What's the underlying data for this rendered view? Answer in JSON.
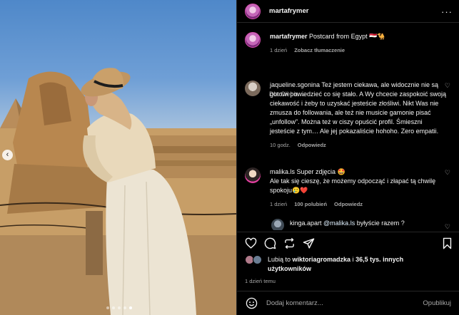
{
  "post": {
    "username": "martafrymer",
    "caption_user": "martafrymer",
    "caption_text": "Postcard from Egypt 🇪🇬🐪",
    "caption_time": "1 dzień",
    "translate_label": "Zobacz tłumaczenie",
    "sort_label": "Dla Ciebie"
  },
  "comments": [
    {
      "user": "jaqueline.sgonina",
      "text": "Też jestem ciekawa, ale widocznie nie są gotowi powiedzieć co się stało. A Wy chcecie zaspokoić swoją ciekawość i żeby to uzyskać jesteście złośliwi. Nikt Was nie zmusza do followania, ale też nie musicie gamonie pisać „unfollow”. Można też w ciszy opuścić profil. Śmieszni jesteście z tym… Ale jej pokazaliście hohoho. Zero empatii.",
      "time": "10 godz.",
      "reply": "Odpowiedz"
    },
    {
      "user": "malika.ls",
      "text": "Super zdjęcia 🤩\nAle tak się cieszę, że możemy odpocząć i złapać tą chwilę spokoju🥲❤️",
      "time": "1 dzień",
      "likes": "100 polubień",
      "reply": "Odpowiedz"
    },
    {
      "user": "kinga.apart",
      "mention": "@malika.ls",
      "text": " byłyście razem ?"
    }
  ],
  "likes": {
    "prefix": "Lubią to ",
    "user": "wiktoriagromadzka",
    "middle": " i ",
    "count": "36,5 tys. innych użytkowników"
  },
  "time_ago": "1 dzień temu",
  "add_comment": {
    "placeholder": "Dodaj komentarz...",
    "post_label": "Opublikuj"
  },
  "icons": [
    "heart-icon",
    "comment-icon",
    "repost-icon",
    "share-icon",
    "bookmark-icon",
    "emoji-icon",
    "more-icon",
    "chevron-left-icon",
    "chevron-down-icon"
  ],
  "colors": {
    "mention": "#e0f1ff",
    "muted": "#a8a8a8",
    "background": "#000000"
  }
}
